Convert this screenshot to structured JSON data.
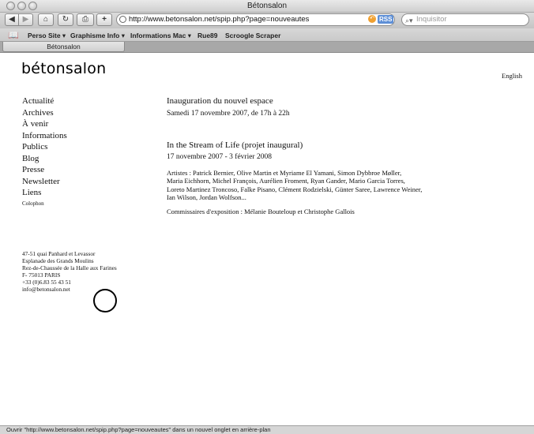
{
  "window": {
    "title": "Bétonsalon"
  },
  "toolbar": {
    "back_label": "◀",
    "forward_label": "▶",
    "home_label": "⌂",
    "reload_label": "↻",
    "print_label": "⎙",
    "add_bookmark_label": "+",
    "url": "http://www.betonsalon.net/spip.php?page=nouveautes",
    "rss_label": "RSS",
    "search_placeholder": "Inquisitor"
  },
  "bookmarks": {
    "items": [
      "Perso Site ▾",
      "Graphisme Info ▾",
      "Informations Mac ▾",
      "Rue89",
      "Scroogle Scraper"
    ]
  },
  "tabs": [
    {
      "label": "Bétonsalon"
    }
  ],
  "site": {
    "logo": "bétonsalon",
    "language_link": "English",
    "menu": [
      "Actualité",
      "Archives",
      "À venir",
      "Informations",
      "Publics",
      "Blog",
      "Presse",
      "Newsletter",
      "Liens"
    ],
    "colophon": "Colophon",
    "event1": {
      "title": "Inauguration du nouvel espace",
      "date": "Samedi 17 novembre 2007, de 17h à 22h"
    },
    "event2": {
      "title": "In the Stream of Life (projet inaugural)",
      "date": "17 novembre 2007 - 3 février 2008",
      "artists_lines": [
        "Artistes : Patrick Bernier, Olive Martin et Myriame El Yamani, Simon Dybbroe Møller,",
        "Maria Eichhorn, Michel François, Aurélien Froment, Ryan Gander, Mario Garcia Torres,",
        "Loreto Martinez Troncoso, Falke Pisano, Clément Rodzielski, Günter Saree, Lawrence Weiner,",
        "Ian Wilson, Jordan Wolfson..."
      ],
      "curators": "Commissaires d'exposition : Mélanie Bouteloup et Christophe Gallois"
    },
    "address_lines": [
      "47-51 quai Panhard et Levassor",
      "Esplanade des Grands Moulins",
      "Rez-de-Chaussée de la Halle aux Farines",
      "F- 75013 PARIS",
      "+33 (0)6.83 55 43 51",
      "info@betonsalon.net"
    ]
  },
  "status": {
    "text": "Ouvrir \"http://www.betonsalon.net/spip.php?page=nouveautes\" dans un nouvel onglet en arrière-plan"
  }
}
